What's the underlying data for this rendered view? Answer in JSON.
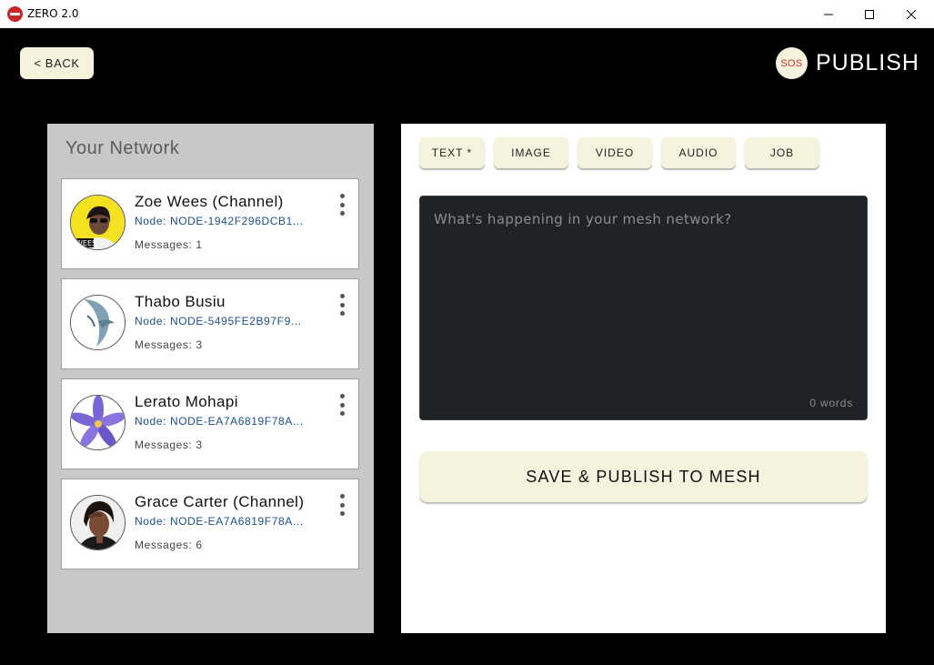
{
  "window": {
    "title": "ZERO 2.0",
    "app_icon": "zero-logo-icon",
    "controls": [
      "minimize-icon",
      "maximize-icon",
      "close-icon"
    ]
  },
  "header": {
    "back_label": "< BACK",
    "sos_label": "SOS",
    "title": "PUBLISH"
  },
  "network": {
    "title": "Your Network",
    "contacts": [
      {
        "name": "Zoe Wees (Channel)",
        "node": "Node: NODE-1942F296DCB1...",
        "messages": "Messages: 1"
      },
      {
        "name": "Thabo Busiu",
        "node": "Node: NODE-5495FE2B97F9...",
        "messages": "Messages: 3"
      },
      {
        "name": "Lerato Mohapi",
        "node": "Node: NODE-EA7A6819F78A...",
        "messages": "Messages: 3"
      },
      {
        "name": "Grace Carter (Channel)",
        "node": "Node: NODE-EA7A6819F78A...",
        "messages": "Messages: 6"
      }
    ]
  },
  "compose": {
    "tabs": [
      "TEXT *",
      "IMAGE",
      "VIDEO",
      "AUDIO",
      "JOB"
    ],
    "active_tab": "TEXT *",
    "placeholder": "What's happening in your mesh network?",
    "word_count": "0 words",
    "publish_label": "SAVE & PUBLISH TO MESH"
  },
  "colors": {
    "background": "#000000",
    "button": "#f5f3dd",
    "panel": "#c8c8c8",
    "editor": "#1f2226",
    "node_text": "#1a4f8c",
    "sos": "#d32f2f"
  }
}
